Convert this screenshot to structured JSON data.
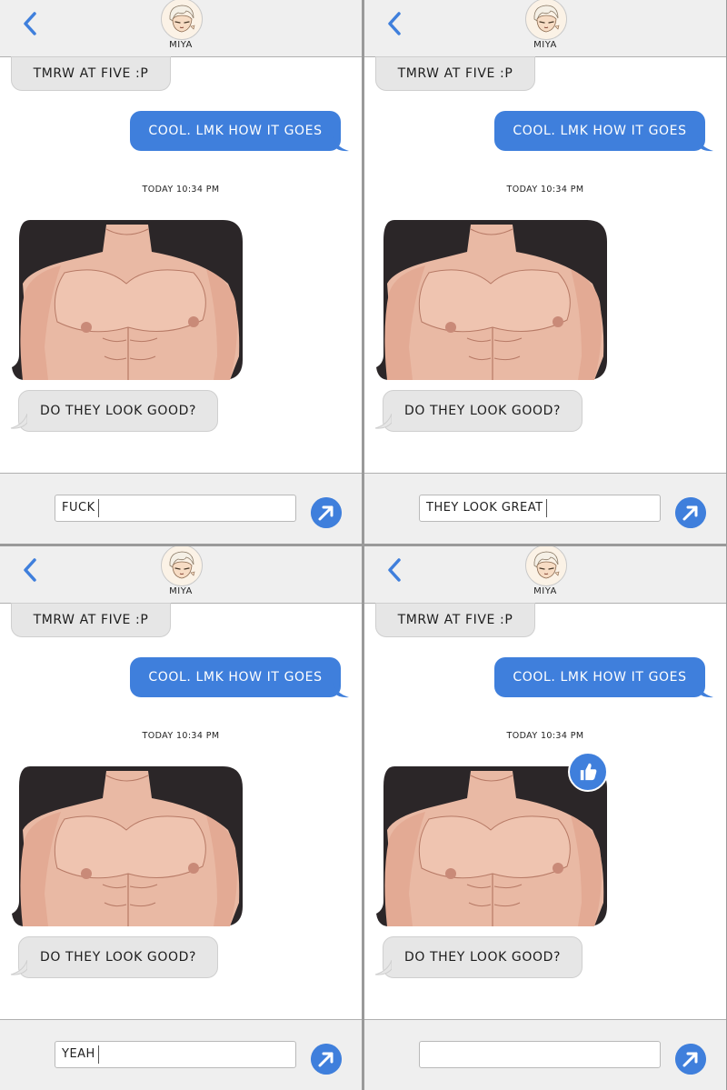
{
  "accent_color": "#3f7fdc",
  "incoming_color": "#e6e6e6",
  "panels": [
    {
      "contact_name": "MIYA",
      "messages": {
        "incoming_first": "TMRW AT FIVE :P",
        "outgoing": "COOL. LMK HOW IT GOES",
        "timestamp": "TODAY  10:34 PM",
        "incoming_last": "DO THEY LOOK GOOD?"
      },
      "input_value": "FUCK",
      "reaction": null
    },
    {
      "contact_name": "MIYA",
      "messages": {
        "incoming_first": "TMRW AT FIVE :P",
        "outgoing": "COOL. LMK HOW IT GOES",
        "timestamp": "TODAY  10:34 PM",
        "incoming_last": "DO THEY LOOK GOOD?"
      },
      "input_value": "THEY LOOK GREAT",
      "reaction": null
    },
    {
      "contact_name": "MIYA",
      "messages": {
        "incoming_first": "TMRW AT FIVE :P",
        "outgoing": "COOL. LMK HOW IT GOES",
        "timestamp": "TODAY  10:34 PM",
        "incoming_last": "DO THEY LOOK GOOD?"
      },
      "input_value": "YEAH",
      "reaction": null
    },
    {
      "contact_name": "MIYA",
      "messages": {
        "incoming_first": "TMRW AT FIVE :P",
        "outgoing": "COOL. LMK HOW IT GOES",
        "timestamp": "TODAY  10:34 PM",
        "incoming_last": "DO THEY LOOK GOOD?"
      },
      "input_value": "",
      "reaction": "thumbs-up-icon"
    }
  ],
  "icons": {
    "back": "chevron-left-icon",
    "send": "arrow-up-right-icon",
    "avatar": "avatar-icon"
  }
}
